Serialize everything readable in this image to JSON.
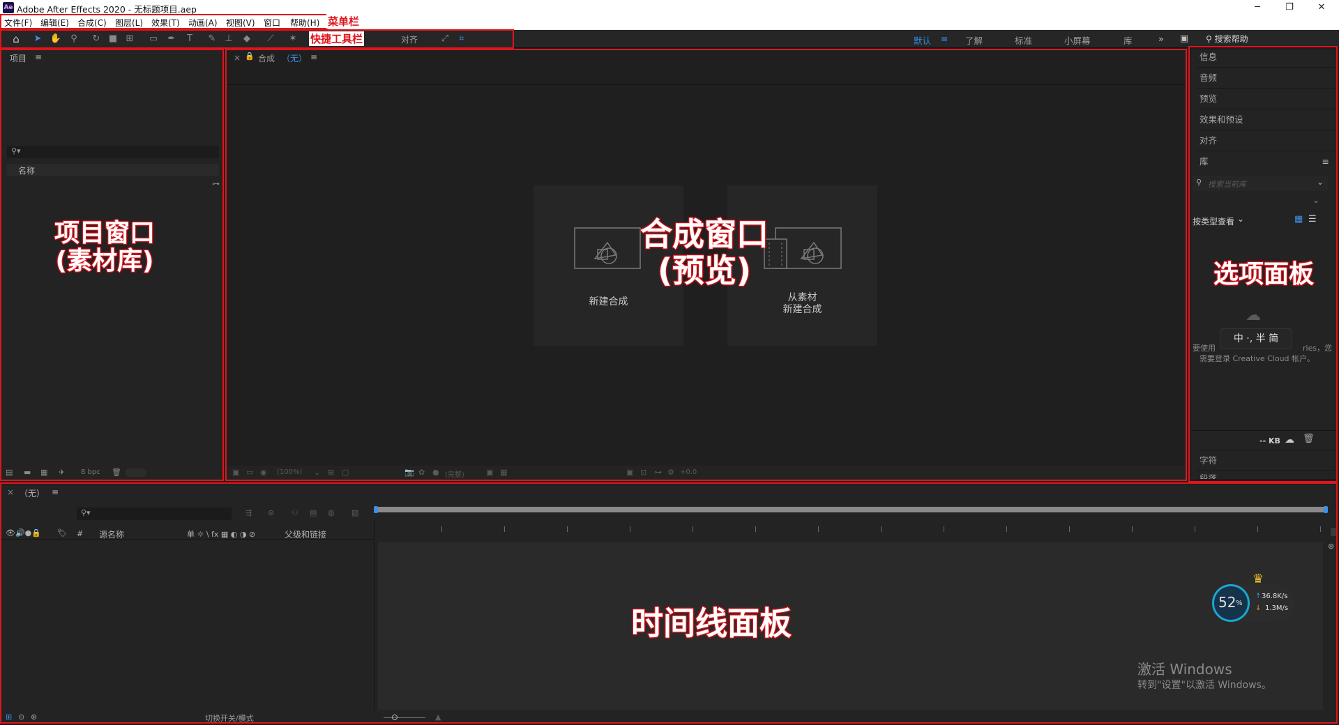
{
  "window": {
    "title": "Adobe After Effects 2020 - 无标题项目.aep",
    "app_icon_text": "Ae",
    "minimize": "─",
    "restore": "❐",
    "close": "✕"
  },
  "menu": {
    "items": [
      "文件(F)",
      "编辑(E)",
      "合成(C)",
      "图层(L)",
      "效果(T)",
      "动画(A)",
      "视图(V)",
      "窗口",
      "帮助(H)"
    ]
  },
  "toolbar": {
    "align_label": "对齐",
    "workspaces": [
      "默认",
      "了解",
      "标准",
      "小屏幕",
      "库"
    ],
    "active_workspace": "默认",
    "more": "»",
    "search_help_label": "搜索帮助"
  },
  "project_panel": {
    "title": "项目",
    "menu_icon": "≡",
    "column_name": "名称",
    "bpc": "8 bpc"
  },
  "comp_panel": {
    "close": "×",
    "title": "合成",
    "comp_name": "（无）",
    "menu_icon": "≡",
    "new_comp_label": "新建合成",
    "from_footage_line1": "从素材",
    "from_footage_line2": "新建合成",
    "zoom": "(100%)",
    "resolution": "(完整)",
    "exposure": "+0.0"
  },
  "side_panel": {
    "items": [
      "信息",
      "音频",
      "预览",
      "效果和预设",
      "对齐"
    ],
    "library_title": "库",
    "library_search_placeholder": "搜索当前库",
    "view_by_type": "按类型查看",
    "signin_text_left": "要使用",
    "signin_text_right": "ries，您",
    "signin_text_line2": "需要登录 Creative Cloud 帐户。",
    "ime_text": "中 ·, 半 简",
    "storage": "-- KB",
    "bottom_items": [
      "字符",
      "段落"
    ]
  },
  "timeline_panel": {
    "close": "×",
    "title": "（无）",
    "menu_icon": "≡",
    "col_hash": "#",
    "col_source_name": "源名称",
    "col_switches": "单 ☼ \\ fx ▦ ◐ ◑ ⊘",
    "col_parent": "父级和链接",
    "toggle_label": "切换开关/模式"
  },
  "overlay": {
    "net_percent": "52",
    "net_percent_unit": "%",
    "upload": "36.8K/s",
    "download": "1.3M/s",
    "watermark_line1": "激活 Windows",
    "watermark_line2": "转到\"设置\"以激活 Windows。"
  },
  "annotations": {
    "menubar": "菜单栏",
    "toolbar": "快捷工具栏",
    "project_line1": "项目窗口",
    "project_line2": "(素材库)",
    "comp_line1": "合成窗口",
    "comp_line2": "(预览)",
    "options": "选项面板",
    "timeline": "时间线面板"
  },
  "colors": {
    "annotation_red": "#e1141c",
    "accent_blue": "#2d8ceb",
    "panel_bg": "#232323"
  }
}
